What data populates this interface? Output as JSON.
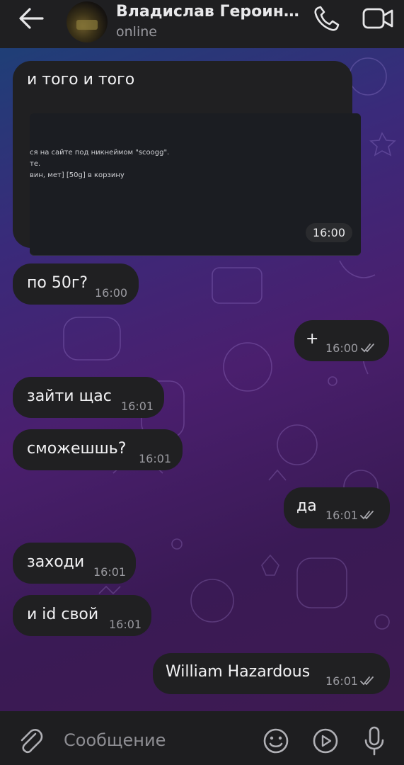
{
  "header": {
    "contact_name": "Владислав Героинов...",
    "status": "online",
    "back_icon": "arrow-left-icon",
    "call_icon": "phone-icon",
    "video_icon": "video-camera-icon"
  },
  "messages": [
    {
      "direction": "in",
      "text": "и того и того",
      "time": "16:00",
      "attachment": {
        "type": "screenshot",
        "lines": [
          "ся на сайте под никнеймом \"scoogg\".",
          "те.",
          "вин, мет] [50g] в корзину"
        ]
      }
    },
    {
      "direction": "in",
      "text": "по 50г?",
      "time": "16:00"
    },
    {
      "direction": "out",
      "text": "+",
      "time": "16:00",
      "status": "read"
    },
    {
      "direction": "in",
      "text": "зайти щас",
      "time": "16:01"
    },
    {
      "direction": "in",
      "text": "сможешшь?",
      "time": "16:01"
    },
    {
      "direction": "out",
      "text": "да",
      "time": "16:01",
      "status": "read"
    },
    {
      "direction": "in",
      "text": "заходи",
      "time": "16:01"
    },
    {
      "direction": "in",
      "text": "и id свой",
      "time": "16:01"
    },
    {
      "direction": "out",
      "text": "William Hazardous",
      "time": "16:01",
      "status": "read"
    }
  ],
  "composer": {
    "placeholder": "Сообщение",
    "attach_icon": "paperclip-icon",
    "emoji_icon": "smiley-icon",
    "round_video_icon": "play-circle-icon",
    "mic_icon": "microphone-icon"
  },
  "colors": {
    "bubble": "#202022",
    "header": "#1f1f21",
    "gradient_top": "#1f3f77",
    "gradient_bottom": "#3e1a52",
    "timestamp": "#9a9aa0"
  }
}
